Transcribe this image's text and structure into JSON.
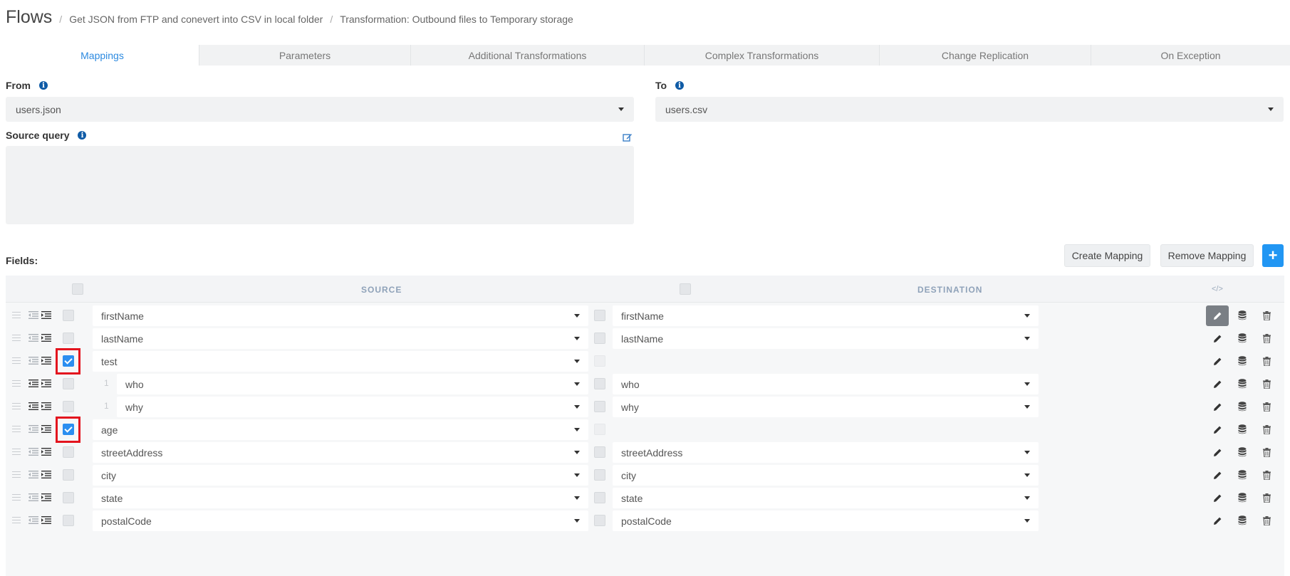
{
  "breadcrumb": {
    "root": "Flows",
    "items": [
      "Get JSON from FTP and conevert into CSV in local folder",
      "Transformation: Outbound files to Temporary storage"
    ]
  },
  "tabs": [
    "Mappings",
    "Parameters",
    "Additional Transformations",
    "Complex Transformations",
    "Change Replication",
    "On Exception"
  ],
  "active_tab": "Mappings",
  "from": {
    "label": "From",
    "value": "users.json"
  },
  "to": {
    "label": "To",
    "value": "users.csv"
  },
  "source_query": {
    "label": "Source query",
    "value": ""
  },
  "fields_label": "Fields:",
  "buttons": {
    "create": "Create Mapping",
    "remove": "Remove Mapping",
    "add": "+"
  },
  "grid": {
    "source_header": "SOURCE",
    "destination_header": "DESTINATION",
    "code_icon": "</>",
    "rows": [
      {
        "source": "firstName",
        "destination": "firstName",
        "level": 0,
        "checked": false
      },
      {
        "source": "lastName",
        "destination": "lastName",
        "level": 0,
        "checked": false
      },
      {
        "source": "test",
        "destination": "",
        "level": 0,
        "checked": true
      },
      {
        "source": "who",
        "destination": "who",
        "level": 1,
        "checked": false,
        "num": "1"
      },
      {
        "source": "why",
        "destination": "why",
        "level": 1,
        "checked": false,
        "num": "1"
      },
      {
        "source": "age",
        "destination": "",
        "level": 0,
        "checked": true
      },
      {
        "source": "streetAddress",
        "destination": "streetAddress",
        "level": 0,
        "checked": false
      },
      {
        "source": "city",
        "destination": "city",
        "level": 0,
        "checked": false
      },
      {
        "source": "state",
        "destination": "state",
        "level": 0,
        "checked": false
      },
      {
        "source": "postalCode",
        "destination": "postalCode",
        "level": 0,
        "checked": false
      }
    ]
  },
  "colors": {
    "accent": "#2d8ae0",
    "highlight": "#e3141e",
    "add_button": "#2196f3"
  }
}
